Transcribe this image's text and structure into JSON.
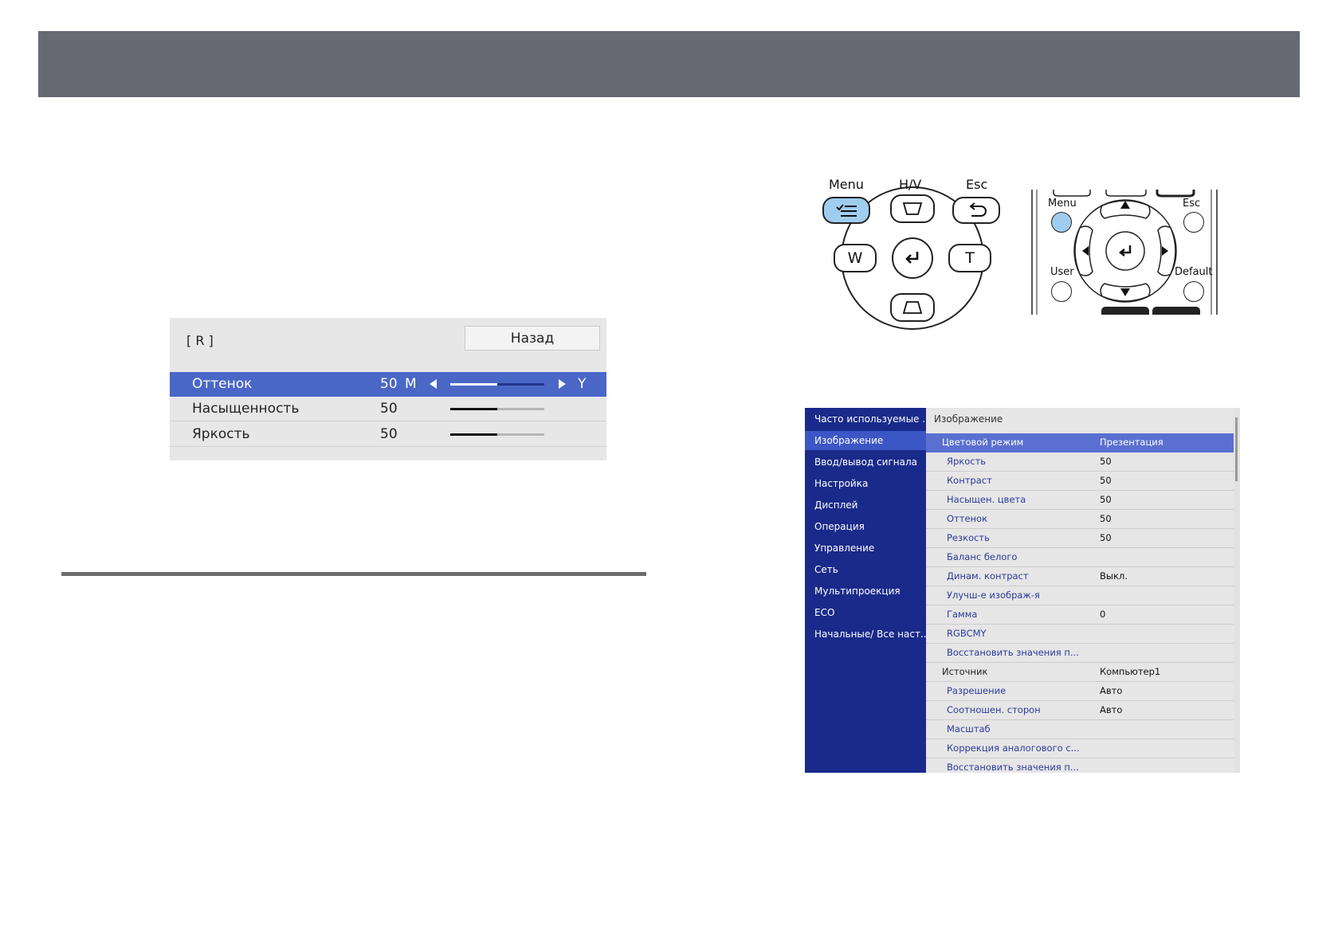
{
  "adjust_panel": {
    "title": "[ R ]",
    "back_label": "Назад",
    "rows": [
      {
        "label": "Оттенок",
        "value": "50",
        "left_mark": "M",
        "right_mark": "Y",
        "level": 0.5
      },
      {
        "label": "Насыщенность",
        "value": "50",
        "level": 0.5
      },
      {
        "label": "Яркость",
        "value": "50",
        "level": 0.5
      }
    ]
  },
  "control_panel": {
    "labels": {
      "menu": "Menu",
      "hv": "H/V",
      "esc": "Esc"
    },
    "keys": {
      "w": "W",
      "t": "T"
    }
  },
  "remote": {
    "labels": {
      "menu": "Menu",
      "esc": "Esc",
      "user": "User",
      "default": "Default"
    }
  },
  "menu": {
    "left_items": [
      {
        "label": "Часто используемые ..."
      },
      {
        "label": "Изображение"
      },
      {
        "label": "Ввод/вывод сигнала"
      },
      {
        "label": "Настройка"
      },
      {
        "label": "Дисплей"
      },
      {
        "label": "Операция"
      },
      {
        "label": "Управление"
      },
      {
        "label": "Сеть"
      },
      {
        "label": "Мультипроекция"
      },
      {
        "label": "ECO"
      },
      {
        "label": "Начальные/ Все наст..."
      }
    ],
    "header": "Изображение",
    "rows": [
      {
        "label": "Цветовой режим",
        "value": "Презентация"
      },
      {
        "label": "Яркость",
        "value": "50"
      },
      {
        "label": "Контраст",
        "value": "50"
      },
      {
        "label": "Насыщен. цвета",
        "value": "50"
      },
      {
        "label": "Оттенок",
        "value": "50"
      },
      {
        "label": "Резкость",
        "value": "50"
      },
      {
        "label": "Баланс белого",
        "value": ""
      },
      {
        "label": "Динам. контраст",
        "value": "Выкл."
      },
      {
        "label": "Улучш-е изображ-я",
        "value": ""
      },
      {
        "label": "Гамма",
        "value": "0"
      },
      {
        "label": "RGBCMY",
        "value": ""
      },
      {
        "label": "Восстановить значения п...",
        "value": ""
      },
      {
        "label": "Источник",
        "value": "Компьютер1"
      },
      {
        "label": "Разрешение",
        "value": "Авто"
      },
      {
        "label": "Соотношен. сторон",
        "value": "Авто"
      },
      {
        "label": "Масштаб",
        "value": ""
      },
      {
        "label": "Коррекция аналогового с...",
        "value": ""
      },
      {
        "label": "Восстановить значения п...",
        "value": ""
      }
    ]
  },
  "colors": {
    "header_bar": "#676a73",
    "selection": "#4a67c6",
    "menu_sidebar": "#1a2a8a",
    "menu_button_highlight": "#9fcdf0"
  }
}
